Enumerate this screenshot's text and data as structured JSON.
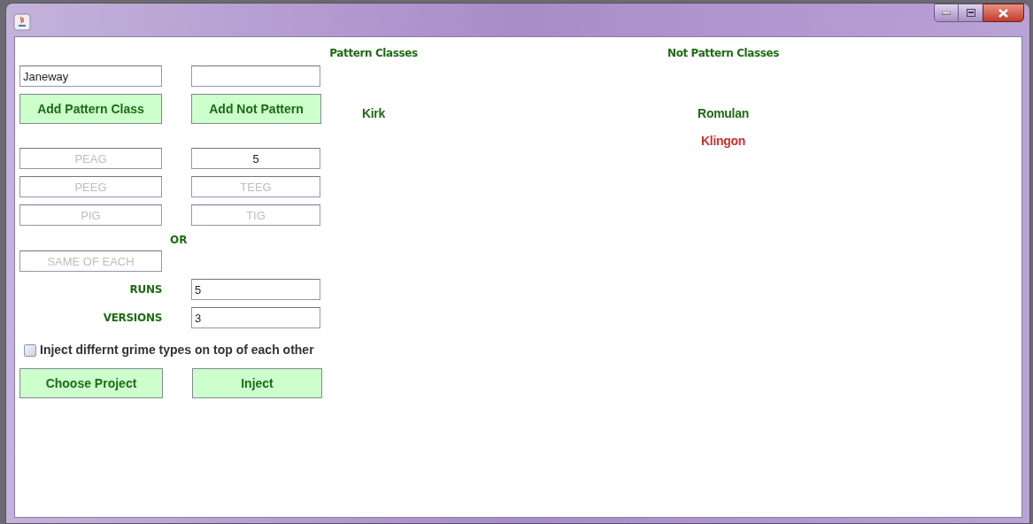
{
  "pattern_classes": {
    "heading": "Pattern Classes",
    "items": [
      {
        "label": "Kirk",
        "color": "#1e6b14"
      }
    ]
  },
  "not_pattern_classes": {
    "heading": "Not Pattern Classes",
    "items": [
      {
        "label": "Romulan",
        "color": "#1e6b14"
      },
      {
        "label": "Klingon",
        "color": "#c83232"
      }
    ]
  },
  "class_input": {
    "value": "Janeway"
  },
  "add_buttons": [
    "Add Pattern Class",
    "Add Not Pattern"
  ],
  "grime_fields": [
    {
      "placeholder": "PEAG"
    },
    {
      "value": "5"
    },
    {
      "placeholder": "PEEG"
    },
    {
      "placeholder": "TEEG"
    },
    {
      "placeholder": "PIG"
    },
    {
      "placeholder": "TIG"
    }
  ],
  "or_label": "OR",
  "same_of_each": {
    "placeholder": "SAME OF EACH"
  },
  "settings": [
    {
      "label": "RUNS",
      "value": "5"
    },
    {
      "label": "VERSIONS",
      "value": "3"
    }
  ],
  "stack_option": {
    "label": "Inject differnt grime types on top of each other",
    "checked": false
  },
  "action_buttons": [
    "Choose Project",
    "Inject"
  ]
}
